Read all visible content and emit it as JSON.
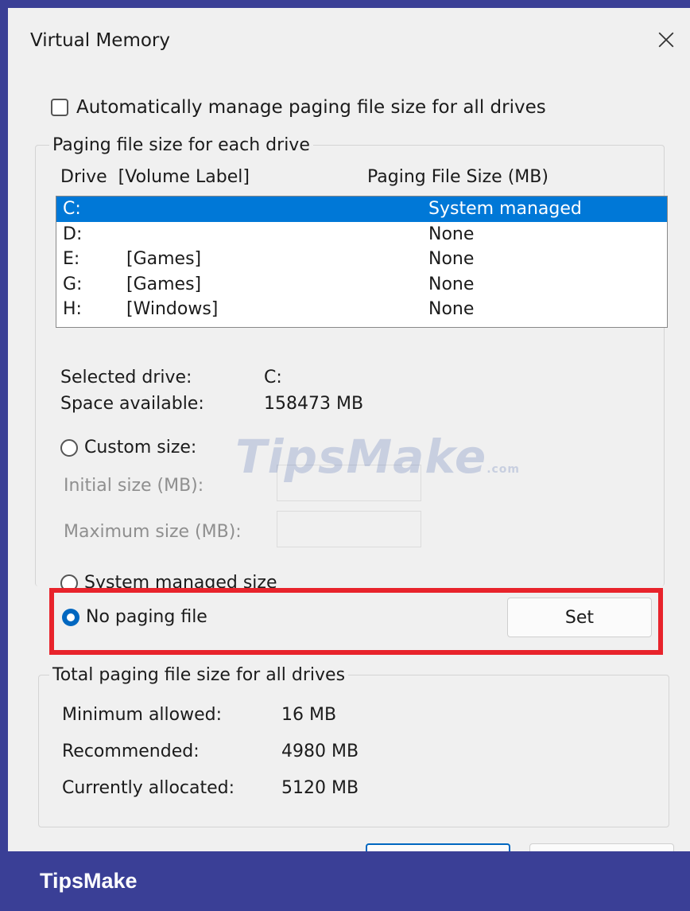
{
  "dialog": {
    "title": "Virtual Memory",
    "close_icon": "close-icon"
  },
  "auto_manage": {
    "label": "Automatically manage paging file size for all drives",
    "checked": false
  },
  "paging_group": {
    "legend": "Paging file size for each drive",
    "col_drive": "Drive  [Volume Label]",
    "col_size": "Paging File Size (MB)",
    "drives": [
      {
        "drive": "C:",
        "label": "",
        "size": "System managed",
        "selected": true
      },
      {
        "drive": "D:",
        "label": "",
        "size": "None",
        "selected": false
      },
      {
        "drive": "E:",
        "label": "[Games]",
        "size": "None",
        "selected": false
      },
      {
        "drive": "G:",
        "label": "[Games]",
        "size": "None",
        "selected": false
      },
      {
        "drive": "H:",
        "label": "[Windows]",
        "size": "None",
        "selected": false
      }
    ],
    "selected_drive_label": "Selected drive:",
    "selected_drive_value": "C:",
    "space_label": "Space available:",
    "space_value": "158473 MB",
    "custom_size_label": "Custom size:",
    "initial_size_label": "Initial size (MB):",
    "maximum_size_label": "Maximum size (MB):",
    "system_managed_label": "System managed size",
    "no_paging_label": "No paging file",
    "selected_option": "no-paging",
    "set_label": "Set"
  },
  "totals_group": {
    "legend": "Total paging file size for all drives",
    "min_label": "Minimum allowed:",
    "min_value": "16 MB",
    "rec_label": "Recommended:",
    "rec_value": "4980 MB",
    "cur_label": "Currently allocated:",
    "cur_value": "5120 MB"
  },
  "watermark": {
    "text": "TipsMake",
    "suffix": ".com"
  },
  "footer": {
    "brand": "TipsMake"
  },
  "colors": {
    "highlight": "#e8232b",
    "selection": "#0078d7",
    "footer": "#3a3f96"
  }
}
